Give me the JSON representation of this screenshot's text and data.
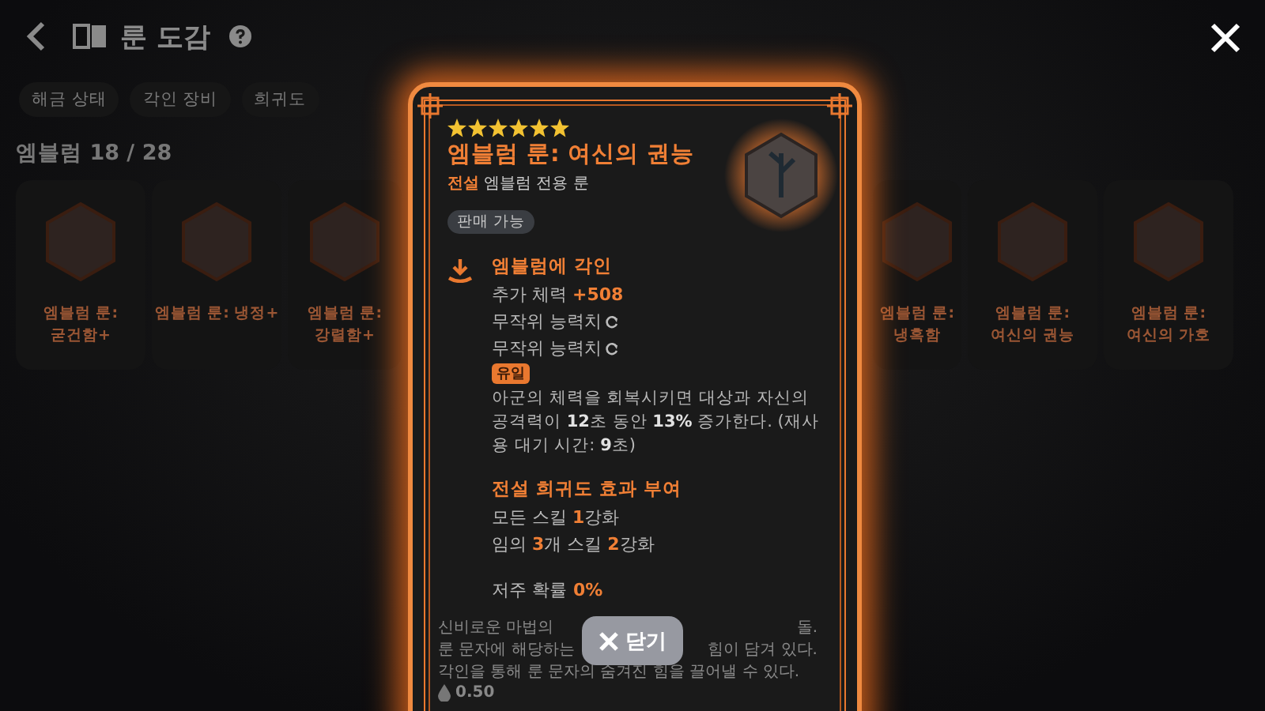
{
  "header": {
    "title": "룬 도감"
  },
  "filters": [
    "해금 상태",
    "각인 장비",
    "희귀도"
  ],
  "collection": {
    "title": "엠블럼 18 / 28"
  },
  "cards": [
    {
      "name": "엠블럼 룬:\n굳건함+"
    },
    {
      "name": "엠블럼 룬: 냉정+"
    },
    {
      "name": "엠블럼 룬:\n강렬함+"
    },
    {
      "name": "엠블럼 룬:\n냉혹함"
    },
    {
      "name": "엠블럼 룬:\n여신의 권능"
    },
    {
      "name": "엠블럼 룬:\n여신의 가호"
    }
  ],
  "detail": {
    "stars": 6,
    "title": "엠블럼 룬: 여신의 권능",
    "rarity": "전설",
    "type": "엠블럼 전용 룬",
    "badge": "판매 가능",
    "engrave": {
      "title": "엠블럼에 각인",
      "lines": [
        {
          "kind": "stat",
          "text": "추가 체력 **+508**"
        },
        {
          "kind": "random",
          "text": "무작위 능력치"
        },
        {
          "kind": "random",
          "text": "무작위 능력치"
        }
      ],
      "tag": "유일",
      "effect": "아군의 체력을 회복시키면 대상과 자신의 공격력이 **12**초 동안 **13%** 증가한다. (재사용 대기 시간: **9**초)"
    },
    "rarity_effect": {
      "title": "전설 희귀도 효과 부여",
      "lines": [
        "모든 스킬 **1**강화",
        "임의 **3**개 스킬 **2**강화"
      ]
    },
    "curse": {
      "label": "저주 확률",
      "value": "0%"
    },
    "lore": [
      [
        "신비로운 마법의",
        "돌."
      ],
      [
        "룬 문자에 해당하는",
        "힘이 담겨 있다."
      ],
      [
        "각인을 통해 룬 문자의 숨겨진 힘을 끌어낼 수 있다."
      ]
    ],
    "price": "0.50"
  },
  "close_button": "닫기"
}
